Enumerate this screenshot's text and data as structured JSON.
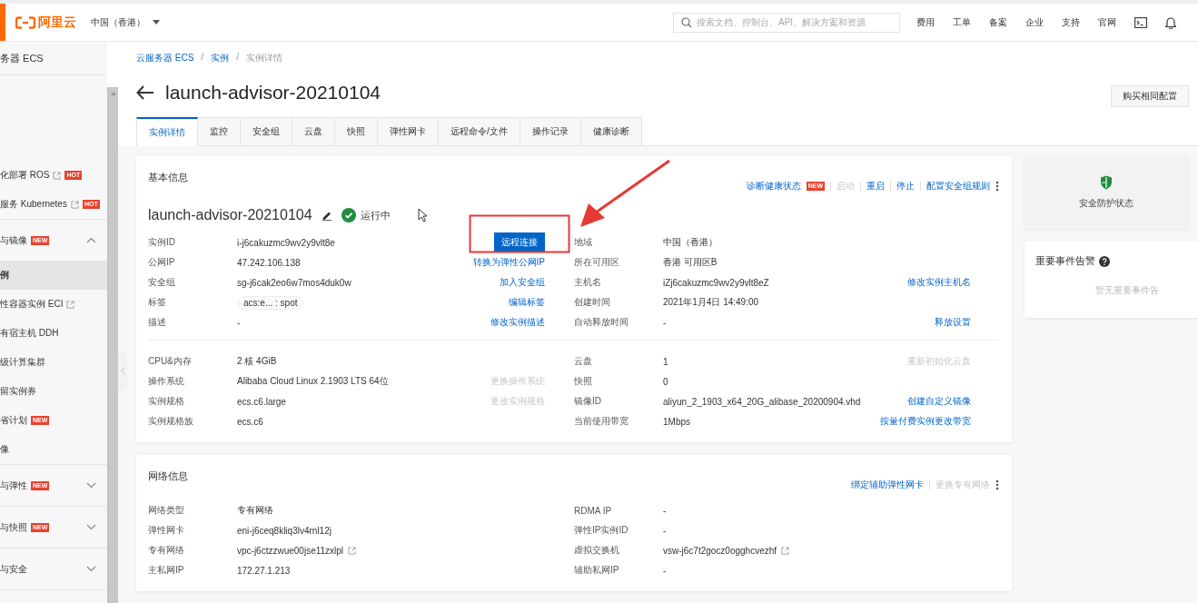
{
  "topbar": {
    "logo": "阿里云",
    "region": "中国（香港）",
    "search": {
      "placeholder": "搜索文档、控制台、API、解决方案和资源"
    },
    "nav": [
      "费用",
      "工单",
      "备案",
      "企业",
      "支持",
      "官网"
    ]
  },
  "sidebar": {
    "title": "务器 ECS",
    "items": [
      {
        "kind": "link",
        "label": "化部署 ROS",
        "external": true,
        "badge": "HOT",
        "selected": false
      },
      {
        "kind": "link",
        "label": "服务 Kubernetes",
        "external": true,
        "badge": "HOT",
        "selected": false
      },
      {
        "kind": "group",
        "label": "与镜像",
        "badge": "NEW",
        "expanded": true,
        "selected": false
      },
      {
        "kind": "link",
        "label": "例",
        "selected": true
      },
      {
        "kind": "link",
        "label": "性容器实例 ECI",
        "external": true,
        "selected": false
      },
      {
        "kind": "link",
        "label": "有宿主机 DDH",
        "selected": false
      },
      {
        "kind": "link",
        "label": "级计算集群",
        "selected": false
      },
      {
        "kind": "link",
        "label": "留实例券",
        "selected": false
      },
      {
        "kind": "link",
        "label": "省计划",
        "badge": "NEW",
        "selected": false
      },
      {
        "kind": "link",
        "label": "像",
        "selected": false
      },
      {
        "kind": "group",
        "label": "与弹性",
        "badge": "NEW",
        "expanded": false,
        "selected": false
      },
      {
        "kind": "group",
        "label": "与快照",
        "badge": "NEW",
        "expanded": false,
        "selected": false
      },
      {
        "kind": "group",
        "label": "与安全",
        "expanded": false,
        "selected": false
      }
    ]
  },
  "breadcrumb": [
    {
      "label": "云服务器 ECS",
      "kind": "link"
    },
    {
      "label": "/",
      "kind": "separator"
    },
    {
      "label": "实例",
      "kind": "link"
    },
    {
      "label": "/",
      "kind": "separator"
    },
    {
      "label": "实例详情",
      "kind": "current"
    }
  ],
  "page_title": "launch-advisor-20210104",
  "header_button": "购买相同配置",
  "tabs": [
    {
      "label": "实例详情",
      "selected": true
    },
    {
      "label": "监控",
      "selected": false
    },
    {
      "label": "安全组",
      "selected": false
    },
    {
      "label": "云盘",
      "selected": false
    },
    {
      "label": "快照",
      "selected": false
    },
    {
      "label": "弹性网卡",
      "selected": false
    },
    {
      "label": "远程命令/文件",
      "selected": false
    },
    {
      "label": "操作记录",
      "selected": false
    },
    {
      "label": "健康诊断",
      "selected": false
    }
  ],
  "basic": {
    "title": "基本信息",
    "actions": [
      {
        "label": "诊断健康状态",
        "badge": "NEW",
        "disabled": false
      },
      {
        "label": "启动",
        "disabled": true
      },
      {
        "label": "重启",
        "disabled": false
      },
      {
        "label": "停止",
        "disabled": false
      },
      {
        "label": "配置安全组规则",
        "disabled": false
      }
    ],
    "name": "launch-advisor-20210104",
    "status": "运行中",
    "groups": [
      [
        {
          "left": {
            "label": "实例ID",
            "value": "i-j6cakuzmc9wv2y9vlt8e",
            "action": {
              "label": "远程连接",
              "kind": "button",
              "disabled": false
            }
          },
          "right": {
            "label": "地域",
            "value": "中国（香港）"
          }
        },
        {
          "left": {
            "label": "公网IP",
            "value": "47.242.106.138",
            "action": {
              "label": "转换为弹性公网IP",
              "kind": "link",
              "disabled": false
            }
          },
          "right": {
            "label": "所在可用区",
            "value": "香港 可用区B"
          }
        },
        {
          "left": {
            "label": "安全组",
            "value": "sg-j6cak2eo6w7mos4duk0w",
            "action": {
              "label": "加入安全组",
              "kind": "link",
              "disabled": false
            }
          },
          "right": {
            "label": "主机名",
            "value": "iZj6cakuzmc9wv2y9vlt8eZ",
            "action": {
              "label": "修改实例主机名",
              "kind": "link",
              "disabled": false
            }
          }
        },
        {
          "left": {
            "label": "标签",
            "value": "acs:e... : spot",
            "kind": "tag",
            "action": {
              "label": "编辑标签",
              "kind": "link",
              "disabled": false
            }
          },
          "right": {
            "label": "创建时间",
            "value": "2021年1月4日 14:49:00"
          }
        },
        {
          "left": {
            "label": "描述",
            "value": "-",
            "action": {
              "label": "修改实例描述",
              "kind": "link",
              "disabled": false
            }
          },
          "right": {
            "label": "自动释放时间",
            "value": "-",
            "action": {
              "label": "释放设置",
              "kind": "link",
              "disabled": false
            }
          }
        }
      ],
      [
        {
          "left": {
            "label": "CPU&内存",
            "value": "2 核 4GiB"
          },
          "right": {
            "label": "云盘",
            "value": "1",
            "action": {
              "label": "重新初始化云盘",
              "kind": "link",
              "disabled": true
            }
          }
        },
        {
          "left": {
            "label": "操作系统",
            "value": "Alibaba Cloud Linux 2.1903 LTS 64位",
            "action": {
              "label": "更换操作系统",
              "kind": "link",
              "disabled": true
            }
          },
          "right": {
            "label": "快照",
            "value": "0"
          }
        },
        {
          "left": {
            "label": "实例规格",
            "value": "ecs.c6.large",
            "action": {
              "label": "更改实例规格",
              "kind": "link",
              "disabled": true
            }
          },
          "right": {
            "label": "镜像ID",
            "value": "aliyun_2_1903_x64_20G_alibase_20200904.vhd",
            "action": {
              "label": "创建自定义镜像",
              "kind": "link",
              "disabled": false
            }
          }
        },
        {
          "left": {
            "label": "实例规格族",
            "value": "ecs.c6"
          },
          "right": {
            "label": "当前使用带宽",
            "value": "1Mbps",
            "action": {
              "label": "按量付费实例更改带宽",
              "kind": "link",
              "disabled": false
            }
          }
        }
      ]
    ]
  },
  "network": {
    "title": "网络信息",
    "actions": [
      {
        "label": "绑定辅助弹性网卡",
        "disabled": false
      },
      {
        "label": "更换专有网络",
        "disabled": true
      }
    ],
    "groups": [
      [
        {
          "left": {
            "label": "网络类型",
            "value": "专有网络"
          },
          "right": {
            "label": "RDMA IP",
            "value": "-"
          }
        },
        {
          "left": {
            "label": "弹性网卡",
            "value": "eni-j6ceq8kliq3lv4rnl12j"
          },
          "right": {
            "label": "弹性IP实例ID",
            "value": "-"
          }
        },
        {
          "left": {
            "label": "专有网络",
            "value": "vpc-j6ctzzwue00jse11zxlpl",
            "external": true
          },
          "right": {
            "label": "虚拟交换机",
            "value": "vsw-j6c7t2gocz0ogghcvezhf",
            "external": true
          }
        },
        {
          "left": {
            "label": "主私网IP",
            "value": "172.27.1.213"
          },
          "right": {
            "label": "辅助私网IP",
            "value": "-"
          }
        }
      ]
    ]
  },
  "security": {
    "label": "安全防护状态"
  },
  "alarms": {
    "title": "重要事件告警",
    "empty": "暂无重要事件告"
  }
}
